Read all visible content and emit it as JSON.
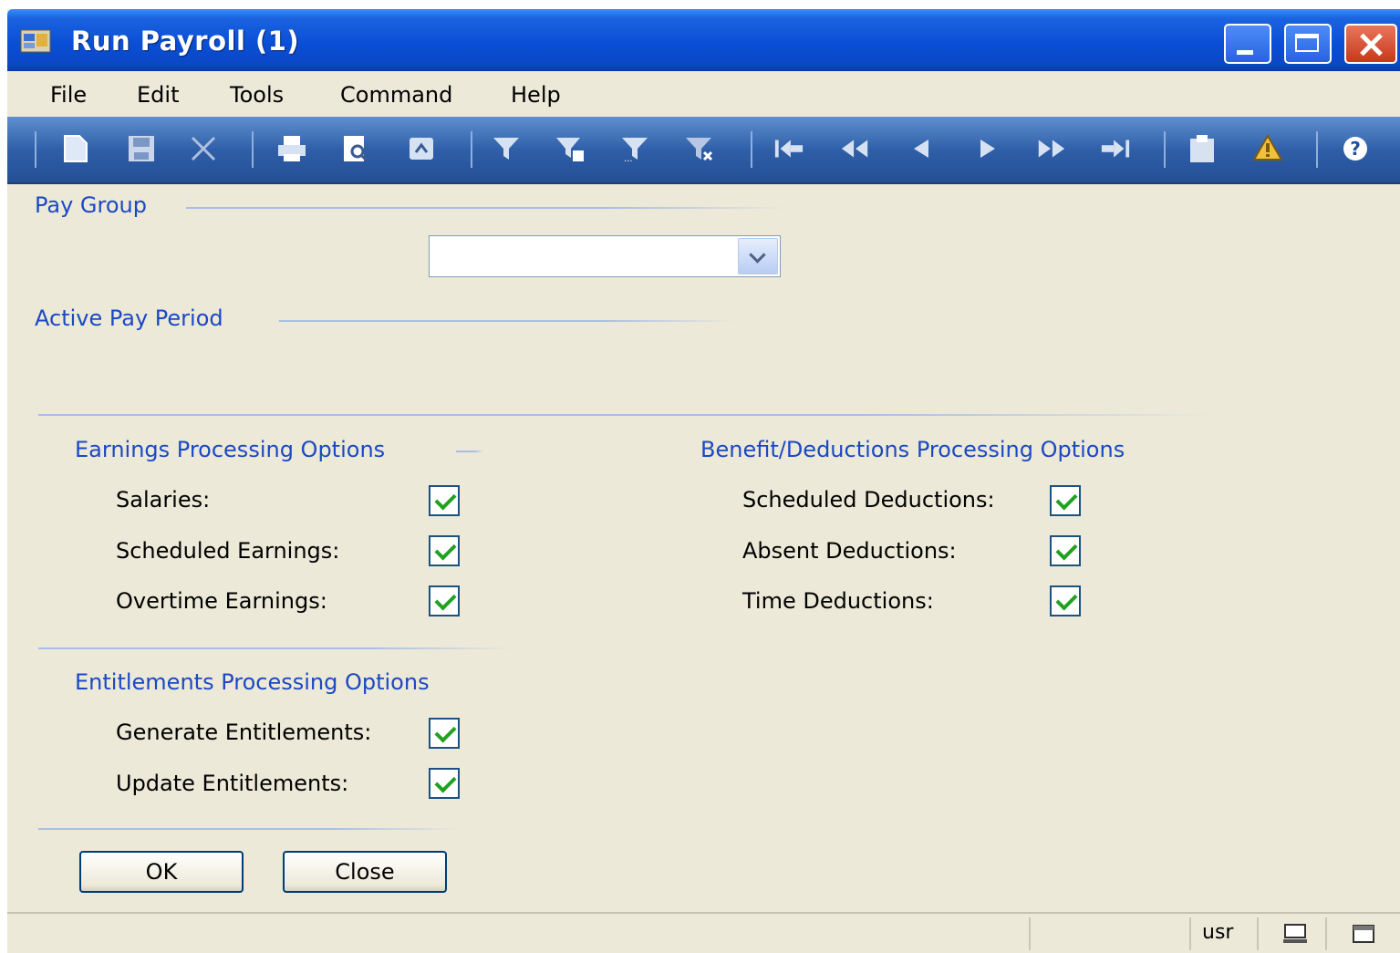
{
  "window": {
    "title": "Run Payroll (1)"
  },
  "menu": [
    "File",
    "Edit",
    "Tools",
    "Command",
    "Help"
  ],
  "toolbar_icons": [
    "new-icon",
    "save-icon",
    "delete-icon",
    "print-icon",
    "print-preview-icon",
    "export-icon",
    "filter-icon",
    "filter-edit-icon",
    "filter-more-icon",
    "clear-filter-icon",
    "first-record-icon",
    "previous-page-icon",
    "previous-record-icon",
    "next-record-icon",
    "next-page-icon",
    "last-record-icon",
    "clipboard-icon",
    "alert-bell-icon",
    "help-icon"
  ],
  "pay_group": {
    "title": "Pay Group",
    "selected": ""
  },
  "active_pay_period": {
    "title": "Active Pay Period"
  },
  "earnings": {
    "title": "Earnings Processing Options",
    "salaries": {
      "label": "Salaries:",
      "checked": true
    },
    "scheduled_earnings": {
      "label": "Scheduled Earnings:",
      "checked": true
    },
    "overtime_earnings": {
      "label": "Overtime Earnings:",
      "checked": true
    }
  },
  "deductions": {
    "title": "Benefit/Deductions Processing Options",
    "scheduled_deductions": {
      "label": "Scheduled Deductions:",
      "checked": true
    },
    "absent_deductions": {
      "label": "Absent Deductions:",
      "checked": true
    },
    "time_deductions": {
      "label": "Time Deductions:",
      "checked": true
    }
  },
  "entitlements": {
    "title": "Entitlements Processing Options",
    "generate": {
      "label": "Generate Entitlements:",
      "checked": true
    },
    "update": {
      "label": "Update Entitlements:",
      "checked": true
    }
  },
  "buttons": {
    "ok": "OK",
    "close": "Close"
  },
  "status": {
    "user": "usr"
  }
}
